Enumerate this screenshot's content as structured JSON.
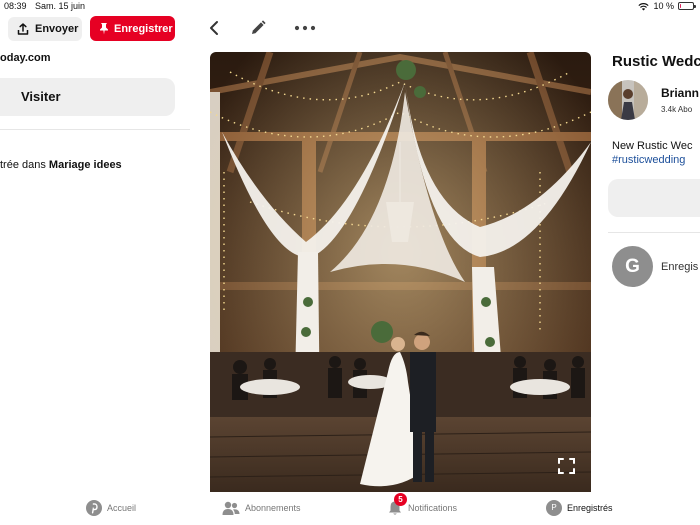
{
  "status_bar": {
    "time": "08:39",
    "date": "Sam. 15 juin",
    "battery": "10 %",
    "battery_level": 0.1
  },
  "actions": {
    "send_label": "Envoyer",
    "save_label": "Enregistrer",
    "icons": [
      "share-icon",
      "pin-icon",
      "back-arrow-icon",
      "pencil-icon",
      "more-dots-icon"
    ]
  },
  "source": {
    "domain": "oday.com",
    "visit_label": "Visiter",
    "saved_in_prefix": "trée dans ",
    "board_name": "Mariage idees"
  },
  "pin": {
    "image_alt": "Barn wedding with white drapes and string lights",
    "title": "Rustic Wedc",
    "creator_name": "Briann",
    "creator_followers": "3.4k Abo",
    "description": "New Rustic Wec",
    "hashtag": "#rusticwedding"
  },
  "activity": {
    "saver_initial": "G",
    "saver_text": "Enregis"
  },
  "tab_bar": {
    "home": "Accueil",
    "subscriptions": "Abonnements",
    "notifications": "Notifications",
    "notifications_count": "5",
    "saved": "Enregistrés",
    "profile_initial": "P"
  },
  "colors": {
    "brand_red": "#e60023",
    "link_blue": "#1c4f9a",
    "button_gray": "#efefef"
  }
}
